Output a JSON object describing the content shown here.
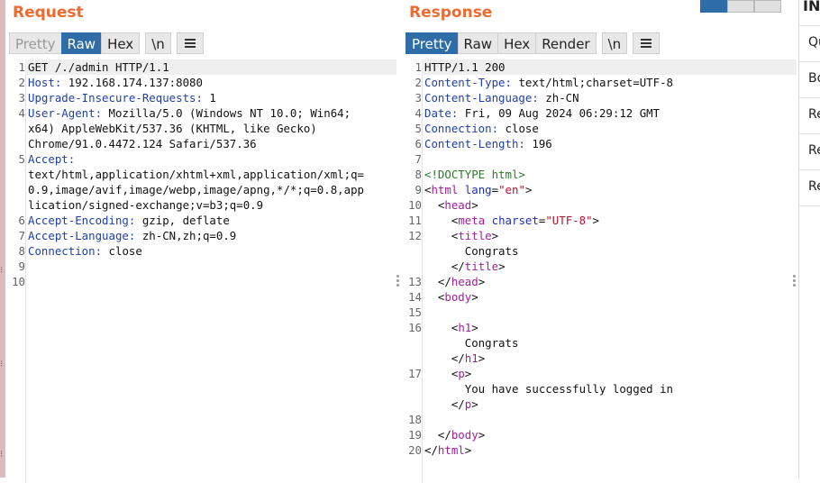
{
  "request": {
    "title": "Request",
    "tabs": [
      "Pretty",
      "Raw",
      "Hex",
      "\\n"
    ],
    "lines": [
      {
        "n": "1",
        "key": "",
        "val": "GET /./admin HTTP/1.1",
        "hl": true
      },
      {
        "n": "2",
        "key": "Host:",
        "val": " 192.168.174.137:8080"
      },
      {
        "n": "3",
        "key": "Upgrade-Insecure-Requests:",
        "val": " 1"
      },
      {
        "n": "4",
        "key": "User-Agent:",
        "val": " Mozilla/5.0 (Windows NT 10.0; Win64;"
      },
      {
        "n": "",
        "key": "",
        "val": "x64) AppleWebKit/537.36 (KHTML, like Gecko)"
      },
      {
        "n": "",
        "key": "",
        "val": "Chrome/91.0.4472.124 Safari/537.36"
      },
      {
        "n": "5",
        "key": "Accept:",
        "val": ""
      },
      {
        "n": "",
        "key": "",
        "val": "text/html,application/xhtml+xml,application/xml;q="
      },
      {
        "n": "",
        "key": "",
        "val": "0.9,image/avif,image/webp,image/apng,*/*;q=0.8,app"
      },
      {
        "n": "",
        "key": "",
        "val": "lication/signed-exchange;v=b3;q=0.9"
      },
      {
        "n": "6",
        "key": "Accept-Encoding:",
        "val": " gzip, deflate"
      },
      {
        "n": "7",
        "key": "Accept-Language:",
        "val": " zh-CN,zh;q=0.9"
      },
      {
        "n": "8",
        "key": "Connection:",
        "val": " close"
      },
      {
        "n": "9",
        "key": "",
        "val": ""
      },
      {
        "n": "10",
        "key": "",
        "val": ""
      }
    ]
  },
  "response": {
    "title": "Response",
    "tabs": [
      "Pretty",
      "Raw",
      "Hex",
      "Render",
      "\\n"
    ],
    "lines": [
      {
        "n": "1",
        "html": "HTTP/1.1 200",
        "hl": true
      },
      {
        "n": "2",
        "html": "<span class=\"k\">Content-Type:</span> text/html;charset=UTF-8"
      },
      {
        "n": "3",
        "html": "<span class=\"k\">Content-Language:</span> zh-CN"
      },
      {
        "n": "4",
        "html": "<span class=\"k\">Date:</span> Fri, 09 Aug 2024 06:29:12 GMT"
      },
      {
        "n": "5",
        "html": "<span class=\"k\">Connection:</span> close"
      },
      {
        "n": "6",
        "html": "<span class=\"k\">Content-Length:</span> 196"
      },
      {
        "n": "7",
        "html": ""
      },
      {
        "n": "8",
        "html": "<span class=\"cm\">&lt;!DOCTYPE html&gt;</span>"
      },
      {
        "n": "9",
        "html": "&lt;<span class=\"tg\">html</span> <span class=\"at\">lang</span>=<span class=\"av\">\"en\"</span>&gt;"
      },
      {
        "n": "10",
        "html": "  &lt;<span class=\"tg\">head</span>&gt;"
      },
      {
        "n": "11",
        "html": "    &lt;<span class=\"tg\">meta</span> <span class=\"at\">charset</span>=<span class=\"av\">\"UTF-8\"</span>&gt;"
      },
      {
        "n": "12",
        "html": "    &lt;<span class=\"tg\">title</span>&gt;"
      },
      {
        "n": "",
        "html": "      Congrats"
      },
      {
        "n": "",
        "html": "    &lt;/<span class=\"tg\">title</span>&gt;"
      },
      {
        "n": "13",
        "html": "  &lt;/<span class=\"tg\">head</span>&gt;"
      },
      {
        "n": "14",
        "html": "  &lt;<span class=\"tg\">body</span>&gt;"
      },
      {
        "n": "15",
        "html": ""
      },
      {
        "n": "16",
        "html": "    &lt;<span class=\"tg\">h1</span>&gt;"
      },
      {
        "n": "",
        "html": "      Congrats"
      },
      {
        "n": "",
        "html": "    &lt;/<span class=\"tg\">h1</span>&gt;"
      },
      {
        "n": "17",
        "html": "    &lt;<span class=\"tg\">p</span>&gt;"
      },
      {
        "n": "",
        "html": "      You have successfully logged in"
      },
      {
        "n": "",
        "html": "    &lt;/<span class=\"tg\">p</span>&gt;"
      },
      {
        "n": "18",
        "html": ""
      },
      {
        "n": "19",
        "html": "  &lt;/<span class=\"tg\">body</span>&gt;"
      },
      {
        "n": "20",
        "html": "&lt;/<span class=\"tg\">html</span>&gt;"
      }
    ]
  },
  "inspector": {
    "title": "IN",
    "items": [
      "Qu",
      "Bo",
      "Re",
      "Re",
      "Re"
    ]
  },
  "colors": {
    "accent": "#ec6b32",
    "active_tab": "#2f6da8"
  }
}
